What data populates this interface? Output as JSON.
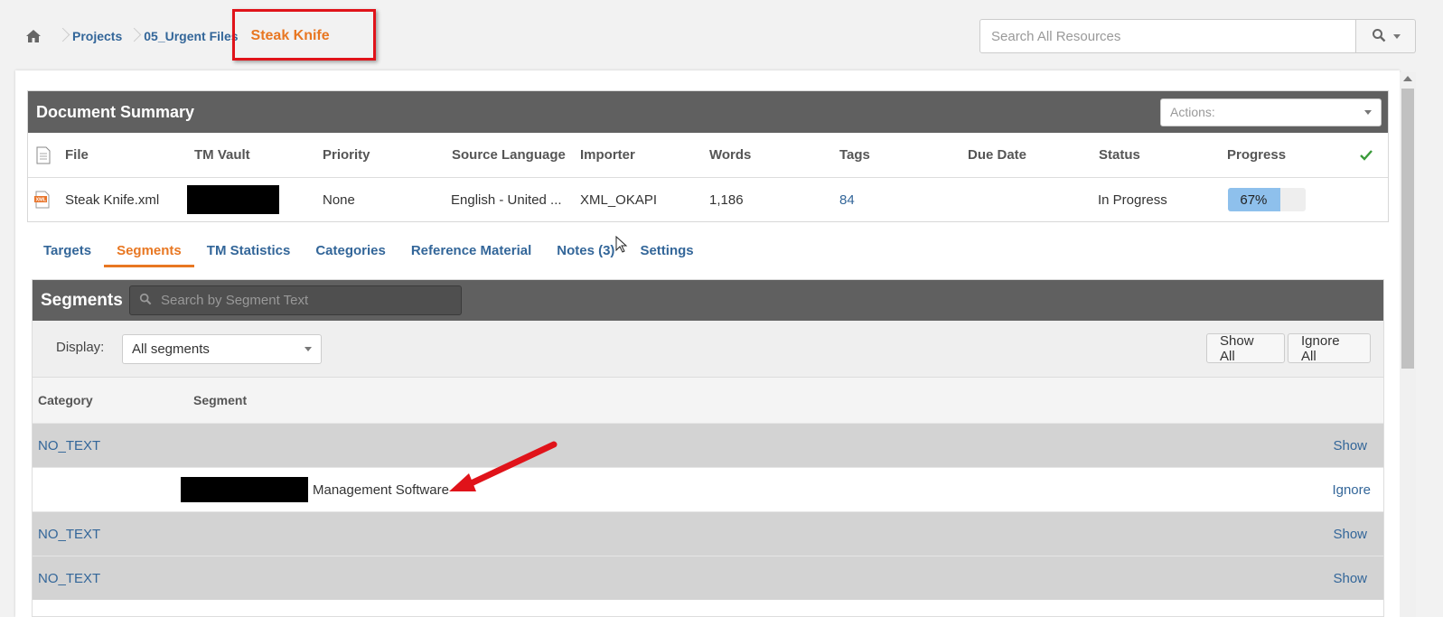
{
  "breadcrumb": {
    "home_icon": "home-icon",
    "items": [
      "Projects",
      "05_Urgent Files"
    ],
    "current": "Steak Knife"
  },
  "search": {
    "placeholder": "Search All Resources"
  },
  "document_summary": {
    "title": "Document Summary",
    "actions_placeholder": "Actions:",
    "columns": [
      "File",
      "TM Vault",
      "Priority",
      "Source Language",
      "Importer",
      "Words",
      "Tags",
      "Due Date",
      "Status",
      "Progress"
    ],
    "row": {
      "file": "Steak Knife.xml",
      "tm_vault": "",
      "priority": "None",
      "source_language": "English - United ...",
      "importer": "XML_OKAPI",
      "words": "1,186",
      "tags": "84",
      "due_date": "",
      "status": "In Progress",
      "progress_label": "67%",
      "progress_value": 0.67
    }
  },
  "tabs": [
    "Targets",
    "Segments",
    "TM Statistics",
    "Categories",
    "Reference Material",
    "Notes (3)",
    "Settings"
  ],
  "active_tab": "Segments",
  "segments": {
    "title": "Segments",
    "search_placeholder": "Search by Segment Text",
    "display_label": "Display:",
    "display_value": "All segments",
    "show_all": "Show All",
    "ignore_all": "Ignore All",
    "columns": [
      "Category",
      "Segment"
    ],
    "rows": [
      {
        "category": "NO_TEXT",
        "segment": "",
        "action": "Show"
      },
      {
        "category": "",
        "segment": "Management Software",
        "action": "Ignore"
      },
      {
        "category": "NO_TEXT",
        "segment": "",
        "action": "Show"
      },
      {
        "category": "NO_TEXT",
        "segment": "",
        "action": "Show"
      }
    ]
  },
  "colors": {
    "accent": "#e87722",
    "link": "#336699",
    "header_bg": "#606060",
    "annotation_red": "#e0131a",
    "progress_fill": "#8ec0ec"
  }
}
